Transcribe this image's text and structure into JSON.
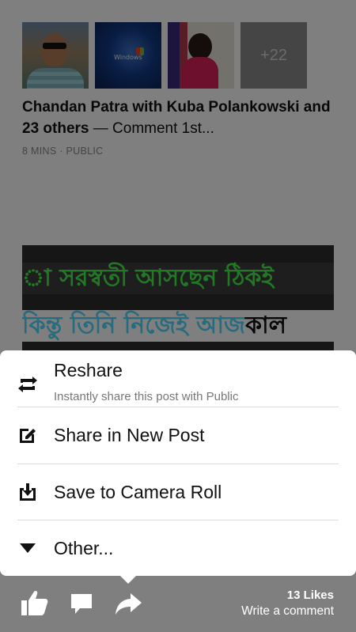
{
  "feed": {
    "more_count": "+22",
    "post_author": "Chandan Patra with Kuba Polankowski and 23 others",
    "post_separator": "—",
    "post_snippet": "Comment 1st...",
    "post_meta": "8 MINS · PUBLIC",
    "thumb_windows_text": "Windows",
    "image_line1": "া সরস্বতী আসছেন ঠিকই",
    "image_line2_a": "কিন্তু তিনি নিজেই আজ",
    "image_line2_b": "কাল"
  },
  "sheet": {
    "items": [
      {
        "label": "Reshare",
        "sublabel": "Instantly share this post with Public",
        "icon": "reshare-icon"
      },
      {
        "label": "Share in New Post",
        "icon": "edit-icon"
      },
      {
        "label": "Save to Camera Roll",
        "icon": "download-icon"
      },
      {
        "label": "Other...",
        "icon": "triangle-down-icon"
      }
    ]
  },
  "bottom_bar": {
    "likes": "13 Likes",
    "write_comment": "Write a comment",
    "icons": [
      "thumbs-up-icon",
      "comment-icon",
      "share-arrow-icon"
    ]
  },
  "colors": {
    "overlay": "#7a7a7a",
    "sheet_bg": "#ffffff",
    "text_primary": "#111111",
    "text_secondary": "#777777"
  }
}
